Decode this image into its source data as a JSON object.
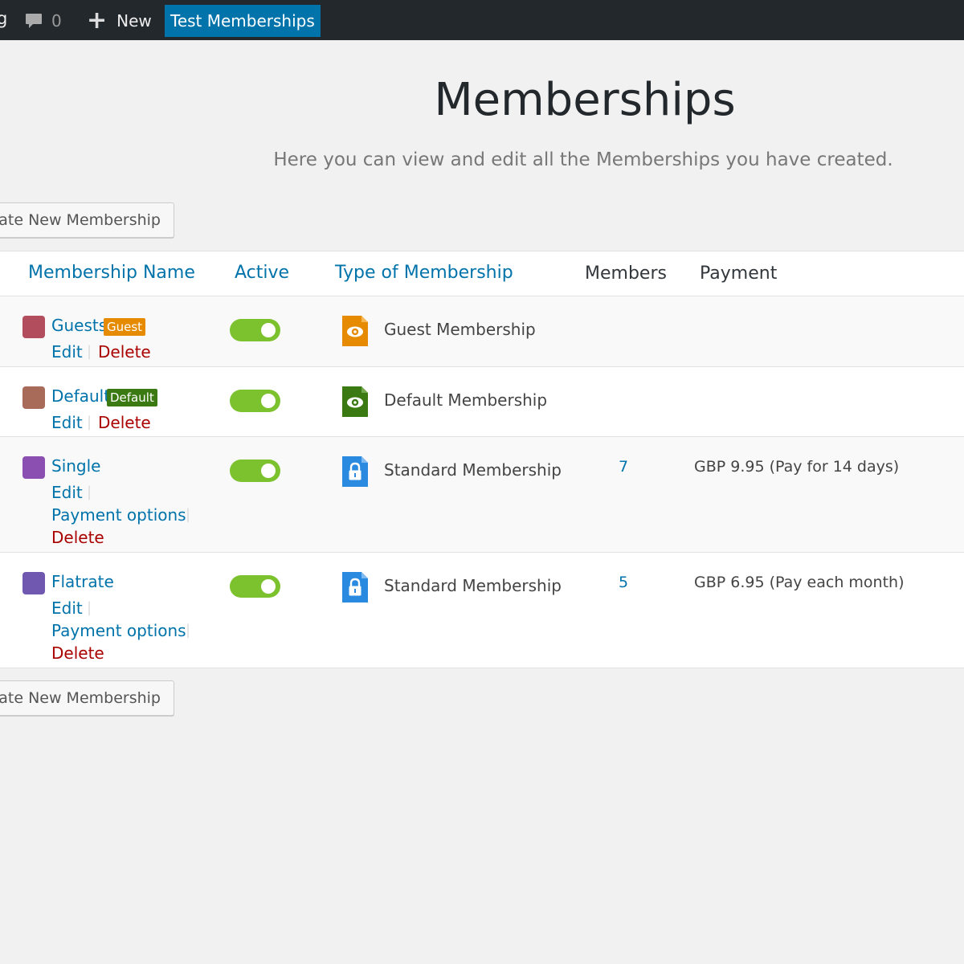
{
  "adminbar": {
    "site_fragment": "g",
    "comments_count": "0",
    "new_label": "New",
    "site_name": "Test Memberships",
    "colors": {
      "bar": "#23282d",
      "active": "#0073aa"
    }
  },
  "page": {
    "title": "Memberships",
    "description": "Here you can view and edit all the Memberships you have created.",
    "create_button": "ate New Membership"
  },
  "table": {
    "headers": {
      "name": "Membership Name",
      "active": "Active",
      "type": "Type of Membership",
      "members": "Members",
      "payment": "Payment"
    },
    "rows": [
      {
        "name": "Guests",
        "badge": "Guest",
        "badge_color": "#e68a00",
        "swatch_color": "#b24d5e",
        "actions": [
          "Edit",
          "Delete"
        ],
        "active": true,
        "type_icon": "eye-icon",
        "type_color": "#e68a00",
        "type_label": "Guest Membership",
        "members": "",
        "payment": ""
      },
      {
        "name": "Default",
        "badge": "Default",
        "badge_color": "#3b7a12",
        "swatch_color": "#a86b5a",
        "actions": [
          "Edit",
          "Delete"
        ],
        "active": true,
        "type_icon": "eye-icon",
        "type_color": "#3b7a12",
        "type_label": "Default Membership",
        "members": "",
        "payment": ""
      },
      {
        "name": "Single",
        "badge": "",
        "swatch_color": "#8a4fb0",
        "actions": [
          "Edit",
          "Payment options",
          "Delete"
        ],
        "active": true,
        "type_icon": "lock-icon",
        "type_color": "#2a8ae0",
        "type_label": "Standard Membership",
        "members": "7",
        "payment": "GBP 9.95 (Pay for 14 days)"
      },
      {
        "name": "Flatrate",
        "badge": "",
        "swatch_color": "#7058b0",
        "actions": [
          "Edit",
          "Payment options",
          "Delete"
        ],
        "active": true,
        "type_icon": "lock-icon",
        "type_color": "#2a8ae0",
        "type_label": "Standard Membership",
        "members": "5",
        "payment": "GBP 6.95 (Pay each month)"
      }
    ]
  },
  "colors": {
    "toggle_on": "#7cc22e",
    "link": "#0073aa",
    "delete": "#aa0000"
  }
}
